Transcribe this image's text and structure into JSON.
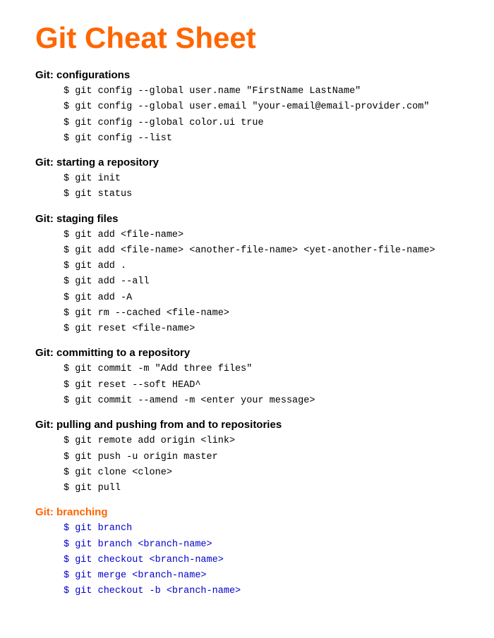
{
  "title": "Git Cheat Sheet",
  "sections": [
    {
      "id": "configurations",
      "heading": "Git: configurations",
      "heading_orange": false,
      "commands": [
        "$ git config --global user.name \"FirstName LastName\"",
        "$ git config --global user.email \"your-email@email-provider.com\"",
        "$ git config --global color.ui true",
        "$ git config --list"
      ],
      "blue": false
    },
    {
      "id": "starting",
      "heading": "Git: starting a repository",
      "heading_orange": false,
      "commands": [
        "$ git init",
        "$ git status"
      ],
      "blue": false
    },
    {
      "id": "staging",
      "heading": "Git: staging files",
      "heading_orange": false,
      "commands": [
        "$ git add <file-name>",
        "$ git add <file-name> <another-file-name> <yet-another-file-name>",
        "$ git add .",
        "$ git add --all",
        "$ git add -A",
        "$ git rm --cached <file-name>",
        "$ git reset <file-name>"
      ],
      "blue": false
    },
    {
      "id": "committing",
      "heading": "Git: committing to a repository",
      "heading_orange": false,
      "commands": [
        "$ git commit -m \"Add three files\"",
        "$ git reset --soft HEAD^",
        "$ git commit --amend -m <enter your message>"
      ],
      "blue": false
    },
    {
      "id": "pulling-pushing",
      "heading": "Git: pulling and pushing from and to repositories",
      "heading_orange": false,
      "commands": [
        "$ git remote add origin <link>",
        "$ git push -u origin master",
        "$ git clone <clone>",
        "$ git pull"
      ],
      "blue": false
    },
    {
      "id": "branching",
      "heading": "Git: branching",
      "heading_orange": true,
      "commands": [
        "$ git branch",
        "$ git branch <branch-name>",
        "$ git checkout <branch-name>",
        "$ git merge <branch-name>",
        "$ git checkout -b <branch-name>"
      ],
      "blue": true
    }
  ]
}
